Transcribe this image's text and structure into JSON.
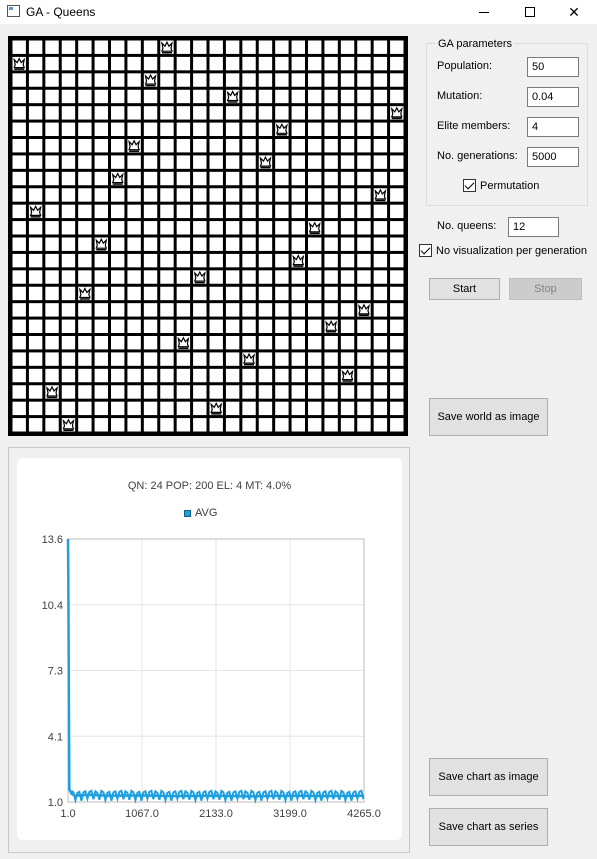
{
  "window": {
    "title": "GA - Queens",
    "minimize_icon": "minimize-icon",
    "maximize_icon": "maximize-icon",
    "close_icon": "close-icon",
    "close_glyph": "✕"
  },
  "board": {
    "size": 24,
    "queen_icon": "queen-icon",
    "queens": [
      [
        0,
        9
      ],
      [
        1,
        0
      ],
      [
        2,
        8
      ],
      [
        3,
        13
      ],
      [
        4,
        23
      ],
      [
        5,
        16
      ],
      [
        6,
        7
      ],
      [
        7,
        15
      ],
      [
        8,
        6
      ],
      [
        9,
        22
      ],
      [
        10,
        1
      ],
      [
        11,
        18
      ],
      [
        12,
        5
      ],
      [
        13,
        17
      ],
      [
        14,
        11
      ],
      [
        15,
        4
      ],
      [
        16,
        21
      ],
      [
        17,
        19
      ],
      [
        18,
        10
      ],
      [
        19,
        14
      ],
      [
        20,
        20
      ],
      [
        21,
        2
      ],
      [
        22,
        12
      ],
      [
        23,
        3
      ]
    ]
  },
  "ga_parameters": {
    "title": "GA parameters",
    "population_label": "Population:",
    "population_value": "50",
    "mutation_label": "Mutation:",
    "mutation_value": "0.04",
    "elite_label": "Elite members:",
    "elite_value": "4",
    "generations_label": "No. generations:",
    "generations_value": "5000",
    "permutation_label": "Permutation",
    "permutation_checked": true
  },
  "queens_label": "No. queens:",
  "queens_value": "12",
  "no_visualization_label": "No visualization per generation",
  "no_visualization_checked": true,
  "buttons": {
    "start": "Start",
    "stop": "Stop",
    "save_world": "Save world as image",
    "save_chart_image": "Save chart as image",
    "save_chart_series": "Save chart as series"
  },
  "chart_data": {
    "type": "line",
    "title": "QN: 24 POP: 200 EL: 4 MT: 4.0%",
    "series": [
      {
        "name": "AVG",
        "color": "#209fdf",
        "x": [
          1,
          5,
          20,
          50,
          100,
          300,
          600,
          1067,
          1500,
          2133,
          2600,
          3199,
          3700,
          4265
        ],
        "y": [
          13.6,
          12.0,
          1.6,
          1.4,
          1.3,
          1.35,
          1.3,
          1.32,
          1.28,
          1.3,
          1.27,
          1.3,
          1.28,
          1.3
        ]
      }
    ],
    "x_ticks": [
      "1.0",
      "1067.0",
      "2133.0",
      "3199.0",
      "4265.0"
    ],
    "y_ticks": [
      "13.6",
      "10.4",
      "7.3",
      "4.1",
      "1.0"
    ],
    "xlim": [
      1.0,
      4265.0
    ],
    "ylim": [
      1.0,
      13.6
    ],
    "grid": true,
    "legend_position": "top"
  }
}
